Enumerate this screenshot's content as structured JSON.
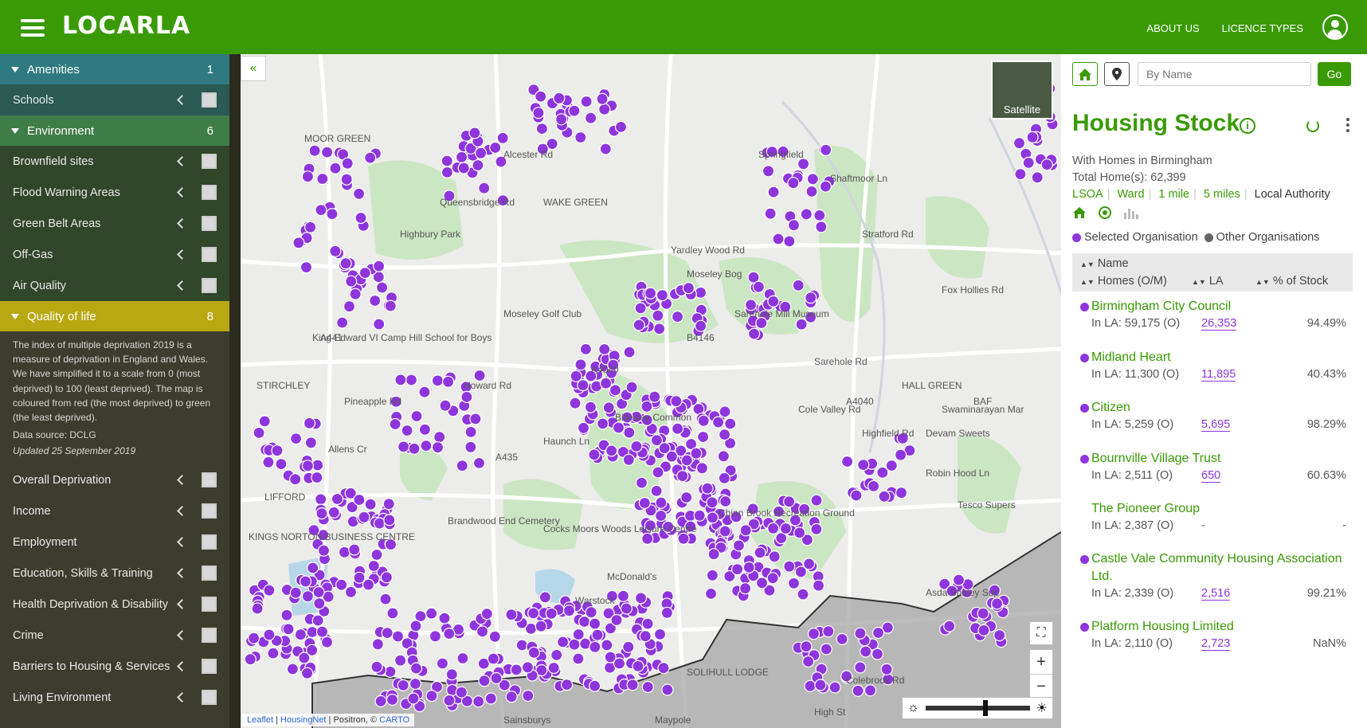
{
  "header": {
    "logo": "LOCARLA",
    "nav": [
      "ABOUT US",
      "LICENCE TYPES"
    ]
  },
  "sidebar": {
    "amenities": {
      "label": "Amenities",
      "count": "1",
      "items": [
        "Schools"
      ]
    },
    "environment": {
      "label": "Environment",
      "count": "6",
      "items": [
        "Brownfield sites",
        "Flood Warning Areas",
        "Green Belt Areas",
        "Off-Gas",
        "Air Quality"
      ]
    },
    "quality_of_life": {
      "label": "Quality of life",
      "count": "8",
      "description": "The index of multiple deprivation 2019 is a measure of deprivation in England and Wales. We have simplified it to a scale from 0 (most deprived) to 100 (least deprived). The map is coloured from red (the most deprived) to green (the least deprived).",
      "source": "Data source: DCLG",
      "updated": "Updated 25 September 2019",
      "items": [
        "Overall Deprivation",
        "Income",
        "Employment",
        "Education, Skills & Training",
        "Health Deprivation & Disability",
        "Crime",
        "Barriers to Housing & Services",
        "Living Environment"
      ]
    }
  },
  "map": {
    "collapse": "«",
    "satellite_label": "Satellite",
    "zoom_in": "+",
    "zoom_out": "−",
    "attribution": {
      "leaflet": "Leaflet",
      "housingnet": "HousingNet",
      "positron": "Positron, ©",
      "carto": "CARTO"
    },
    "place_labels": [
      "MOOR GREEN",
      "WAKE GREEN",
      "Highbury Park",
      "Moseley Golf Club",
      "Sarehole Mill Museum",
      "King Edward VI Camp Hill School for Boys",
      "STIRCHLEY",
      "Howard Rd",
      "Moseley Bog",
      "HALL GREEN",
      "Swaminarayan Mar",
      "Devam Sweets",
      "Billesley Common",
      "Cocks Moors Woods Leisure Centre",
      "Brandwood End Cemetery",
      "Chinn Brook Recreation Ground",
      "KINGS NORTON BUSINESS CENTRE",
      "McDonald's",
      "Asda Shirley Sup",
      "SOLIHULL LODGE",
      "Tesco Supers",
      "Robin Hood Ln",
      "Highfield Rd",
      "Stratford Rd",
      "Fox Hollies Rd",
      "Sarehole Rd",
      "Cole Valley Rd",
      "Yardley Wood Rd",
      "Haunch Ln",
      "A435",
      "A4040",
      "B4146",
      "A441",
      "A4040",
      "Shaftmoor Ln",
      "Springfield",
      "Colebrook Rd",
      "High St",
      "Maypole",
      "Warstock",
      "LIFFORD",
      "Alcester Rd",
      "Queensbridge Rd",
      "Pineapple Rd",
      "Allens Cr",
      "BAF",
      "Sainsburys"
    ]
  },
  "panel": {
    "search_placeholder": "By Name",
    "go": "Go",
    "title": "Housing Stock",
    "subtitle_line1": "With Homes in Birmingham",
    "subtitle_line2": "Total Home(s): 62,399",
    "filters": [
      "LSOA",
      "Ward",
      "1 mile",
      "5 miles",
      "Local Authority"
    ],
    "legend_selected": "Selected Organisation",
    "legend_other": "Other Organisations",
    "table_head": {
      "name": "Name",
      "homes": "Homes (O/M)",
      "la": "LA",
      "pct": "% of Stock"
    },
    "orgs": [
      {
        "name": "Birmingham City Council",
        "in_la": "In LA: 59,175 (O)",
        "la": "26,353",
        "pct": "94.49%",
        "selected": true
      },
      {
        "name": "Midland Heart",
        "in_la": "In LA: 11,300 (O)",
        "la": "11,895",
        "pct": "40.43%",
        "selected": true
      },
      {
        "name": "Citizen",
        "in_la": "In LA: 5,259 (O)",
        "la": "5,695",
        "pct": "98.29%",
        "selected": true
      },
      {
        "name": "Bournville Village Trust",
        "in_la": "In LA: 2,511 (O)",
        "la": "650",
        "pct": "60.63%",
        "selected": true
      },
      {
        "name": "The Pioneer Group",
        "in_la": "In LA: 2,387 (O)",
        "la": "-",
        "pct": "-",
        "selected": false
      },
      {
        "name": "Castle Vale Community Housing Association Ltd.",
        "in_la": "In LA: 2,339 (O)",
        "la": "2,516",
        "pct": "99.21%",
        "selected": true
      },
      {
        "name": "Platform Housing Limited",
        "in_la": "In LA: 2,110 (O)",
        "la": "2,723",
        "pct": "NaN%",
        "selected": true
      }
    ]
  },
  "colors": {
    "brand_green": "#3a9a05",
    "purple_marker": "#8e35dc",
    "park_green": "#cbe6c2",
    "water_blue": "#b6d6ea"
  }
}
